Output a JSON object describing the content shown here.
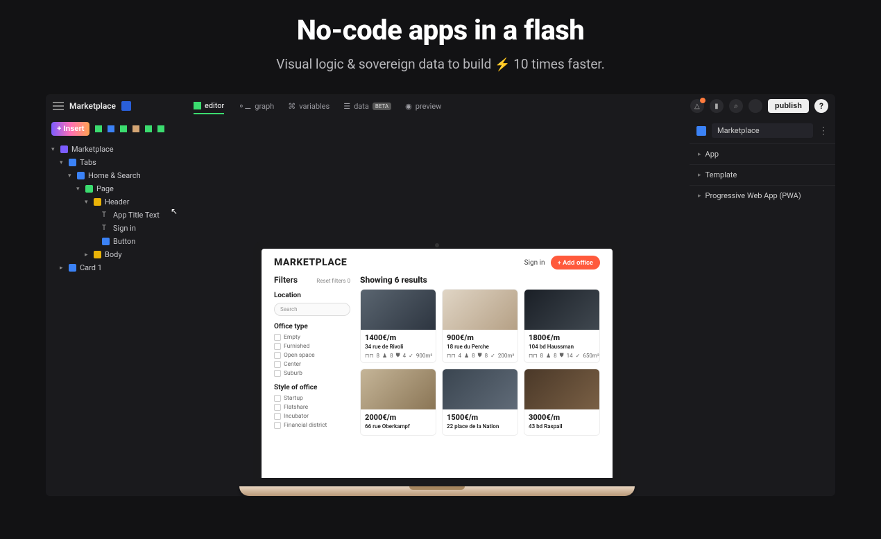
{
  "hero": {
    "title": "No-code apps in a flash",
    "subtitle_pre": "Visual logic & sovereign data to build ",
    "subtitle_post": " 10 times faster."
  },
  "topbar": {
    "project": "Marketplace",
    "tabs": {
      "editor": "editor",
      "graph": "graph",
      "variables": "variables",
      "data": "data",
      "data_badge": "BETA",
      "preview": "preview"
    },
    "publish": "publish"
  },
  "tree": {
    "insert": "Insert",
    "marketplace": "Marketplace",
    "tabs": "Tabs",
    "home_search": "Home & Search",
    "page": "Page",
    "header": "Header",
    "app_title_text": "App Title Text",
    "sign_in": "Sign in",
    "button": "Button",
    "body": "Body",
    "card1": "Card 1"
  },
  "rightpanel": {
    "name": "Marketplace",
    "sections": {
      "app": "App",
      "template": "Template",
      "pwa": "Progressive Web App (PWA)"
    }
  },
  "marketplace": {
    "title": "MARKETPLACE",
    "signin": "Sign in",
    "add_office": "+ Add office",
    "filters": "Filters",
    "reset": "Reset filters",
    "reset_count": "0",
    "showing": "Showing 6 results",
    "location_label": "Location",
    "search_placeholder": "Search",
    "office_type_label": "Office type",
    "office_types": {
      "empty": "Empty",
      "furnished": "Furnished",
      "open_space": "Open space",
      "center": "Center",
      "suburb": "Suburb"
    },
    "style_label": "Style of office",
    "styles": {
      "startup": "Startup",
      "flatshare": "Flatshare",
      "incubator": "Incubator",
      "financial": "Financial district"
    },
    "cards": [
      {
        "price": "1400€/m",
        "addr": "34 rue de Rivoli",
        "desks": "8",
        "chairs": "8",
        "parking": "4",
        "area": "900m²"
      },
      {
        "price": "900€/m",
        "addr": "18 rue du Perche",
        "desks": "4",
        "chairs": "8",
        "parking": "8",
        "area": "200m²"
      },
      {
        "price": "1800€/m",
        "addr": "104 bd Haussman",
        "desks": "8",
        "chairs": "8",
        "parking": "14",
        "area": "650m²"
      },
      {
        "price": "2000€/m",
        "addr": "66 rue Oberkampf",
        "desks": "",
        "chairs": "",
        "parking": "",
        "area": ""
      },
      {
        "price": "1500€/m",
        "addr": "22 place de la Nation",
        "desks": "",
        "chairs": "",
        "parking": "",
        "area": ""
      },
      {
        "price": "3000€/m",
        "addr": "43 bd Raspail",
        "desks": "",
        "chairs": "",
        "parking": "",
        "area": ""
      }
    ]
  }
}
